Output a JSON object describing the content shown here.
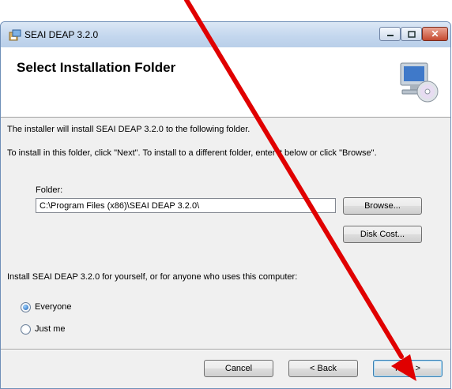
{
  "window": {
    "title": "SEAI DEAP 3.2.0",
    "controls": {
      "minimize_icon": "minimize-icon",
      "maximize_icon": "maximize-icon",
      "close_icon": "close-icon",
      "close_glyph": "✕"
    }
  },
  "banner": {
    "title": "Select Installation Folder",
    "icon": "computer-cd-icon"
  },
  "body": {
    "intro_line": "The installer will install SEAI DEAP 3.2.0 to the following folder.",
    "instruction_line": "To install in this folder, click \"Next\". To install to a different folder, enter it below or click \"Browse\".",
    "folder_label": "Folder:",
    "folder_value": "C:\\Program Files (x86)\\SEAI DEAP 3.2.0\\",
    "browse_label": "Browse...",
    "disk_cost_label": "Disk Cost...",
    "install_for_label": "Install SEAI DEAP 3.2.0 for yourself, or for anyone who uses this computer:",
    "options": [
      {
        "label": "Everyone",
        "selected": true
      },
      {
        "label": "Just me",
        "selected": false
      }
    ]
  },
  "footer": {
    "cancel_label": "Cancel",
    "back_label": "< Back",
    "next_label": "Next >"
  },
  "annotation": {
    "arrow_color": "#e00000"
  }
}
